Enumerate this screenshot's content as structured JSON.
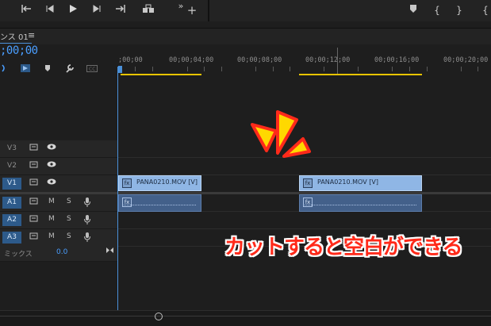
{
  "transport": {
    "icons": [
      "mark-in-icon",
      "step-back-icon",
      "play-icon",
      "step-forward-icon",
      "mark-out-icon",
      "export-frame-icon",
      "more-icon",
      "add-icon"
    ],
    "right_icons": [
      "marker-icon",
      "in-brace-icon",
      "out-brace-icon",
      "go-in-icon"
    ]
  },
  "sequence": {
    "name": "ンス 01",
    "timecode": ";00;00"
  },
  "ruler": {
    "labels": [
      ";00;00",
      "00;00;04;00",
      "00;00;08;00",
      "00;00;12;00",
      "00;00;16;00",
      "00;00;20;00"
    ]
  },
  "tracks": [
    {
      "id": "V3",
      "active": false
    },
    {
      "id": "V2",
      "active": false
    },
    {
      "id": "V1",
      "active": true
    },
    {
      "id": "A1",
      "active": true
    },
    {
      "id": "A2",
      "active": true
    },
    {
      "id": "A3",
      "active": true
    }
  ],
  "audio_controls": {
    "mute": "M",
    "solo": "S"
  },
  "clips": {
    "video": [
      {
        "name": "PANA0210.MOV [V]"
      },
      {
        "name": "PANA0210.MOV [V]"
      }
    ],
    "fx_label": "fx"
  },
  "mix": {
    "label": "ミックス",
    "value": "0.0"
  },
  "annotation": {
    "text": "カットすると空白ができる"
  },
  "colors": {
    "accent": "#4a90d9",
    "annotation_text": "#ff2a1a",
    "annotation_outline": "#ffffff",
    "burst": "#ffd800",
    "video_clip": "#8fb6e5",
    "audio_clip": "#43608a",
    "yellow_bar": "#e8c400"
  }
}
